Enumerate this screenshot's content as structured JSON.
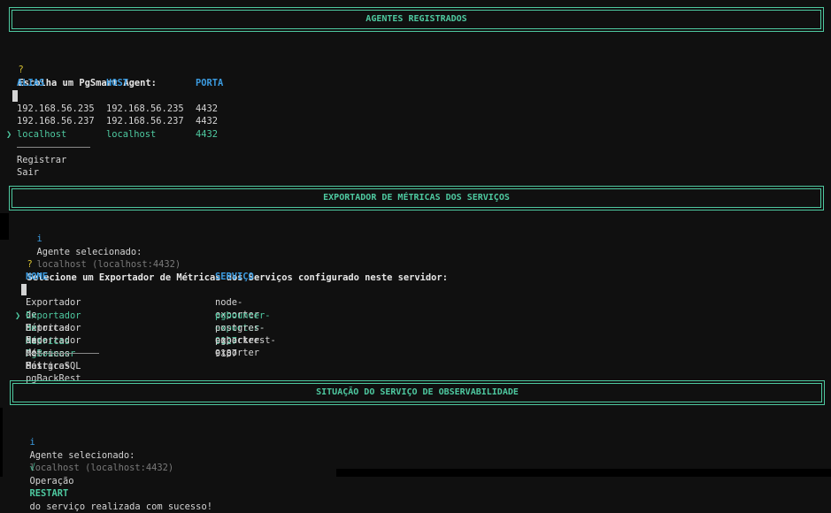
{
  "section1": {
    "title": "AGENTES REGISTRADOS",
    "prompt_mark": "?",
    "prompt": "Escolha um PgSmart Agent:",
    "headers": [
      "ALIAS",
      "HOST",
      "PORTA"
    ],
    "rows": [
      {
        "alias": "192.168.56.235",
        "host": "192.168.56.235",
        "port": "4432"
      },
      {
        "alias": "192.168.56.237",
        "host": "192.168.56.237",
        "port": "4432"
      },
      {
        "alias": "localhost",
        "host": "localhost",
        "port": "4432"
      }
    ],
    "pointer": "❯",
    "separator": "──────────────",
    "actions": [
      "Registrar",
      "Sair"
    ]
  },
  "section2": {
    "title": "EXPORTADOR DE MÉTRICAS DOS SERVIÇOS",
    "info_mark": "i",
    "info_label": "Agente selecionado:",
    "info_value": "localhost (localhost:4432)",
    "prompt_mark": "?",
    "prompt": "Selecione um Exportador de Métricas dos Serviços configurado neste servidor:",
    "headers": [
      "NOME",
      "SERVIÇO"
    ],
    "rows": [
      {
        "name": "Exportador de Métricas Node",
        "service": "node-exporter"
      },
      {
        "name": "Exportador de Métricas PgBouncer",
        "service": "pgbouncer-exporter-9127"
      },
      {
        "name": "Exportador de Métricas PostgreSQL",
        "service": "postgres-exporter-9187"
      },
      {
        "name": "Exportador de Métricas pgBackRest",
        "service": "pgbackrest-exporter"
      }
    ],
    "pointer": "❯",
    "separator": "──────────────",
    "actions": [
      "Sair"
    ]
  },
  "section3": {
    "title": "SITUAÇÃO DO SERVIÇO DE OBSERVABILIDADE",
    "info_mark": "i",
    "info_label": "Agente selecionado:",
    "info_value": "localhost (localhost:4432)",
    "ok_mark": "√",
    "msg_before": "Operação",
    "msg_keyword": "RESTART",
    "msg_after": "do serviço realizada com sucesso!"
  },
  "colors": {
    "accent": "#4ec9a0",
    "header": "#3b9be0",
    "prompt": "#d7c030",
    "dim": "#7a7a7a"
  }
}
